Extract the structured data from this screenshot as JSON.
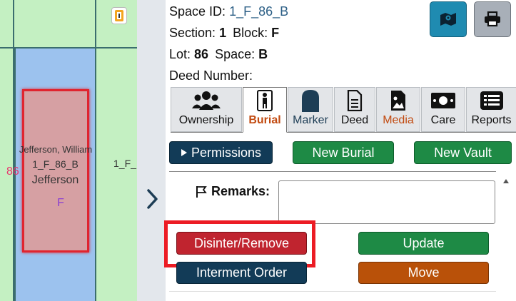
{
  "map": {
    "plot_owner": "Jefferson, William",
    "plot_id": "1_F_86_B",
    "plot_name": "Jefferson",
    "plot_section": "F",
    "lot_number": "86",
    "neighbor_label": "1_F_"
  },
  "info": {
    "space_id_label": "Space ID:",
    "space_id_value": "1_F_86_B",
    "section_label": "Section:",
    "section_value": "1",
    "block_label": "Block:",
    "block_value": "F",
    "lot_label": "Lot:",
    "lot_value": "86",
    "space_label": "Space:",
    "space_value": "B",
    "deed_label": "Deed Number:"
  },
  "tabs": [
    {
      "label": "Ownership",
      "icon": "users-icon"
    },
    {
      "label": "Burial",
      "icon": "person-coffin-icon",
      "active": true
    },
    {
      "label": "Marker",
      "icon": "headstone-icon"
    },
    {
      "label": "Deed",
      "icon": "document-icon"
    },
    {
      "label": "Media",
      "icon": "image-icon"
    },
    {
      "label": "Care",
      "icon": "money-icon"
    },
    {
      "label": "Reports",
      "icon": "list-icon"
    }
  ],
  "actions": {
    "permissions": "Permissions",
    "new_burial": "New Burial",
    "new_vault": "New Vault",
    "remarks_label": "Remarks:",
    "remarks_value": "",
    "disinter": "Disinter/Remove",
    "update": "Update",
    "interment_order": "Interment Order",
    "move": "Move"
  },
  "colors": {
    "map_green": "#c4f0c2",
    "plot_blue": "#9cc2ee",
    "plot_selected": "#d6a0a3",
    "highlight_red": "#ec1c24",
    "accent_orange": "#c24a10",
    "button_green": "#1e8a45",
    "button_navy": "#123b57"
  }
}
